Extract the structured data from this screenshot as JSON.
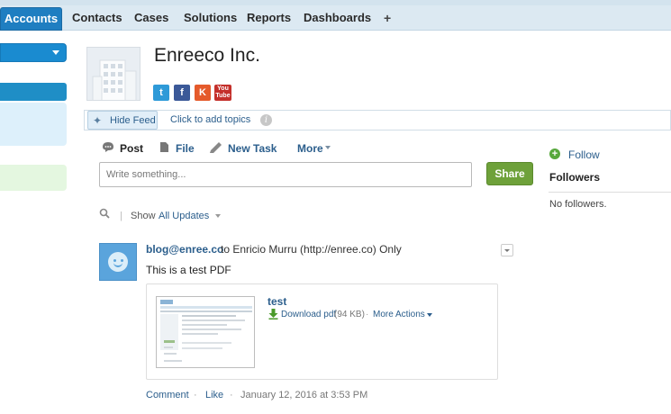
{
  "nav": {
    "tabs": [
      "Accounts",
      "Contacts",
      "Cases",
      "Solutions",
      "Reports",
      "Dashboards"
    ],
    "plus": "+"
  },
  "record": {
    "title": "Enreeco Inc.",
    "social": {
      "twitter": "t",
      "facebook": "f",
      "klout": "K",
      "youtube_top": "You",
      "youtube_bottom": "Tube"
    }
  },
  "feedbar": {
    "hide_feed": "Hide Feed",
    "add_topics": "Click to add topics",
    "info": "i"
  },
  "publisher": {
    "actions": [
      "Post",
      "File",
      "New Task",
      "More"
    ],
    "placeholder": "Write something...",
    "share": "Share"
  },
  "filter": {
    "separator": "|",
    "show": "Show",
    "value": "All Updates"
  },
  "feed_item": {
    "author": "blog@enree.co",
    "audience": "to Enricio Murru (http://enree.co) Only",
    "body": "This is a test PDF",
    "attachment": {
      "title": "test",
      "download": "Download pdf",
      "size": "(94 KB)",
      "more_actions": "More Actions"
    },
    "footer": {
      "comment": "Comment",
      "like": "Like",
      "timestamp": "January 12, 2016 at 3:53 PM"
    }
  },
  "sidebar_right": {
    "follow": "Follow",
    "followers_title": "Followers",
    "no_followers": "No followers."
  },
  "colors": {
    "nav_active": "#1f7ec1",
    "link": "#2b5e8c",
    "share_green": "#6ea13a"
  }
}
